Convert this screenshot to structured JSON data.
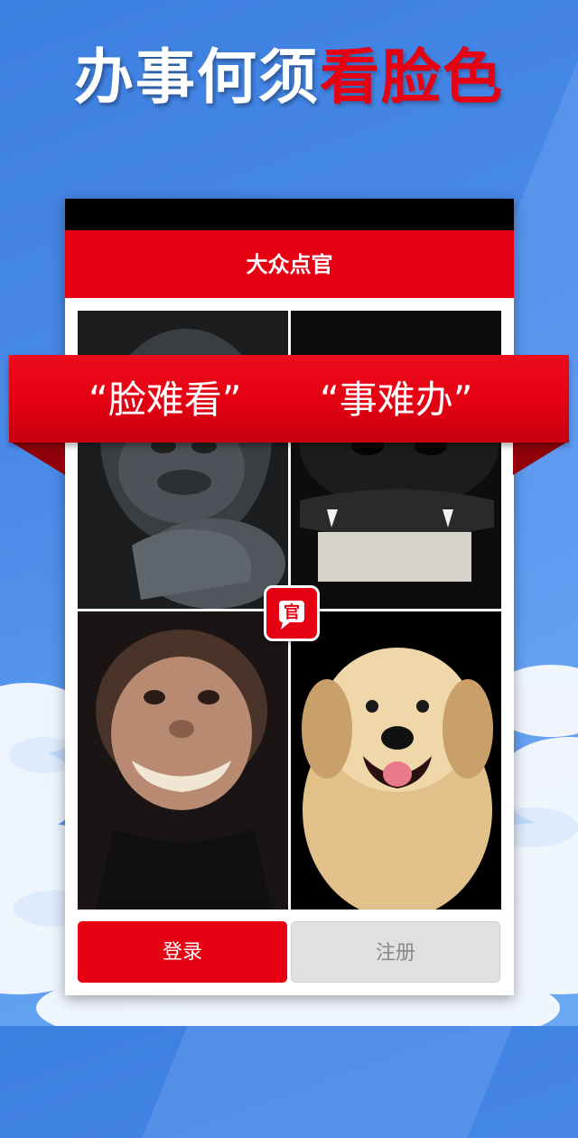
{
  "headline": {
    "white_part": "办事何须",
    "red_part": "看脸色"
  },
  "app": {
    "title": "大众点官",
    "login_label": "登录",
    "register_label": "注册"
  },
  "ribbon": {
    "left_text": "“脸难看”",
    "right_text": "“事难办”"
  },
  "tiles": [
    {
      "subject": "gorilla-photo"
    },
    {
      "subject": "dog-snout-photo"
    },
    {
      "subject": "chimpanzee-photo"
    },
    {
      "subject": "puppy-photo"
    }
  ],
  "badge": {
    "glyph": "官"
  },
  "colors": {
    "brand_red": "#e60012",
    "sky_blue": "#4a8be8",
    "black": "#000000"
  }
}
